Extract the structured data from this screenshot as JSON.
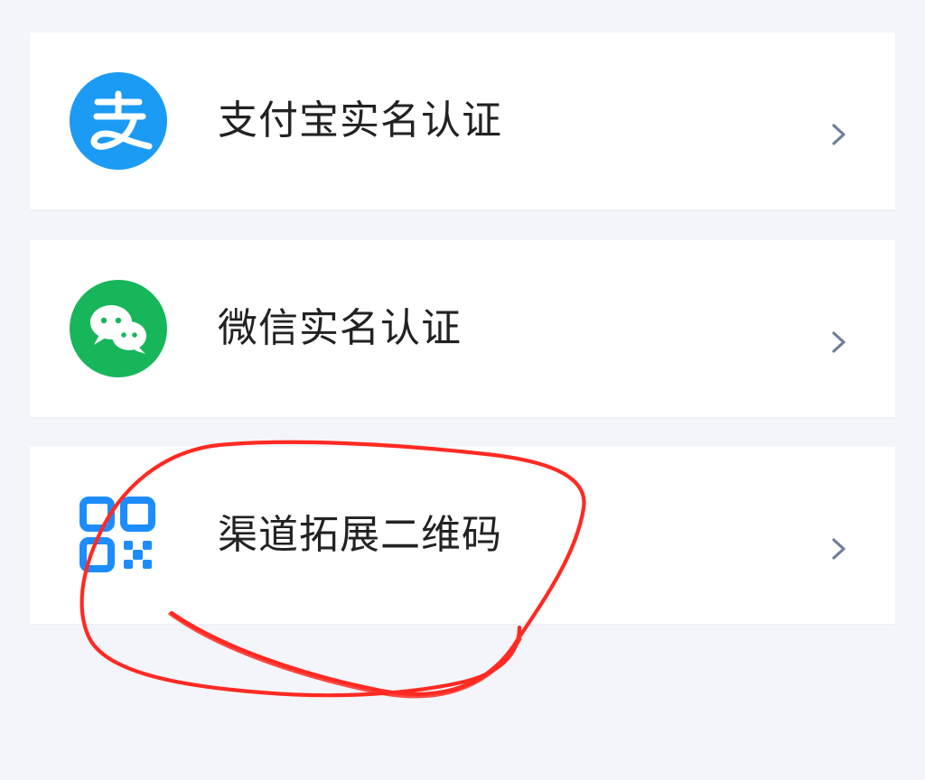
{
  "items": [
    {
      "label": "支付宝实名认证",
      "icon": "alipay-icon",
      "icon_color": "#1677ff"
    },
    {
      "label": "微信实名认证",
      "icon": "wechat-icon",
      "icon_color": "#07c160"
    },
    {
      "label": "渠道拓展二维码",
      "icon": "qr-code-icon",
      "icon_color": "#1d8cff"
    }
  ],
  "chevron_icon": "chevron-right-icon",
  "annotation": {
    "type": "hand-drawn-circle",
    "color": "#ff2a22"
  }
}
